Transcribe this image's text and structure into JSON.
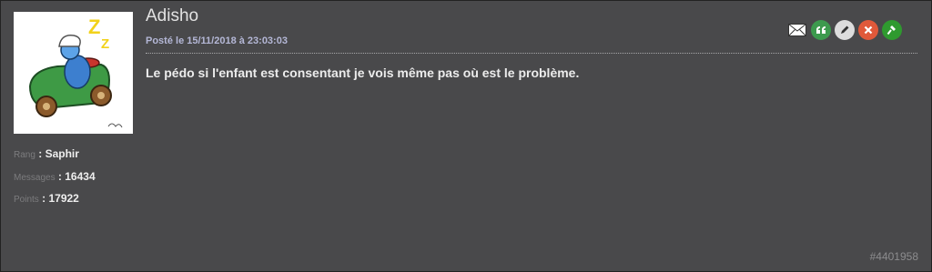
{
  "post": {
    "author": "Adisho",
    "date": "Posté le 15/11/2018 à 23:03:03",
    "message": "Le pédo si l'enfant est consentant je vois même pas où est le problème.",
    "post_id": "#4401958"
  },
  "user": {
    "rank_label": "Rang",
    "rank_value": ": Saphir",
    "messages_label": "Messages",
    "messages_value": ": 16434",
    "points_label": "Points",
    "points_value": ": 17922"
  },
  "avatar": {
    "letter": "Z"
  },
  "actions": [
    {
      "name": "mail-icon",
      "color": "#ffffff"
    },
    {
      "name": "quote-icon",
      "color": "#3d9a4e"
    },
    {
      "name": "edit-icon",
      "color": "#dddddd"
    },
    {
      "name": "delete-icon",
      "color": "#e0593a"
    },
    {
      "name": "moderate-icon",
      "color": "#2f9a2f"
    }
  ]
}
